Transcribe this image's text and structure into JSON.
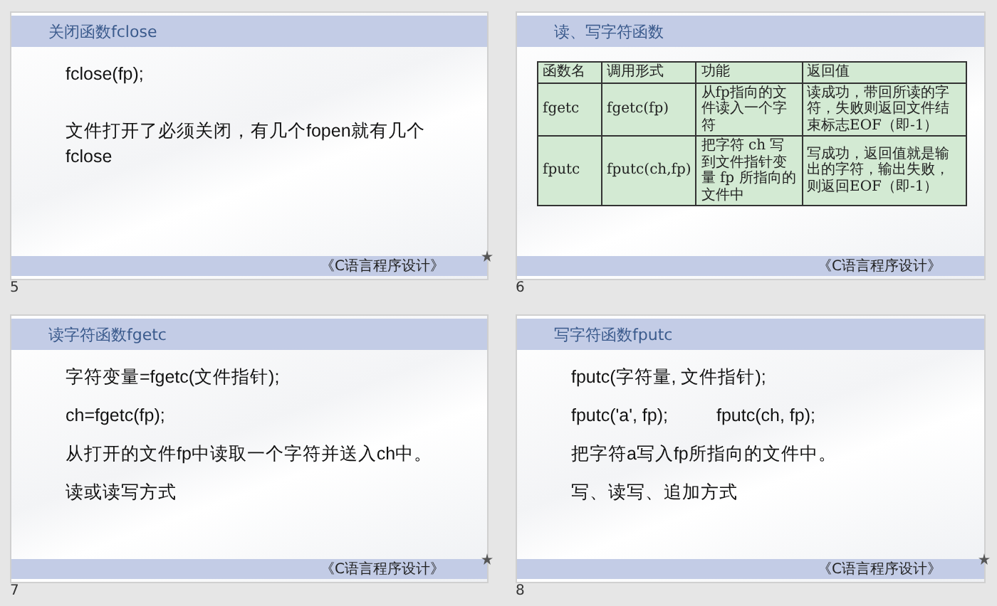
{
  "slides": [
    {
      "number": "5",
      "title": "关闭函数fclose",
      "footer": "《C语言程序设计》",
      "animated": true,
      "body": [
        {
          "kind": "paragraph",
          "texts": [
            "fclose(fp);"
          ]
        },
        {
          "kind": "spacer"
        },
        {
          "kind": "paragraph",
          "texts": [
            "文件打开了必须关闭，有几个fopen就有几个fclose"
          ]
        }
      ]
    },
    {
      "number": "6",
      "title": "读、写字符函数",
      "footer": "《C语言程序设计》",
      "animated": false,
      "body": [
        {
          "kind": "table",
          "columns": [
            "函数名",
            "调用形式",
            "功能",
            "返回值"
          ],
          "rows": [
            [
              "fgetc",
              "fgetc(fp)",
              "从fp指向的文件读入一个字符",
              "读成功，带回所读的字符，失败则返回文件结束标志EOF（即-1）"
            ],
            [
              "fputc",
              "fputc(ch,fp)",
              "把字符 ch 写到文件指针变量 fp 所指向的文件中",
              "写成功，返回值就是输出的字符，输出失败，则返回EOF（即-1）"
            ]
          ]
        }
      ]
    },
    {
      "number": "7",
      "title": "读字符函数fgetc",
      "footer": "《C语言程序设计》",
      "animated": true,
      "body": [
        {
          "kind": "paragraph",
          "texts": [
            "字符变量=fgetc(文件指针);"
          ]
        },
        {
          "kind": "paragraph",
          "texts": [
            "ch=fgetc(fp);"
          ]
        },
        {
          "kind": "paragraph",
          "texts": [
            "从打开的文件fp中读取一个字符并送入ch中。"
          ]
        },
        {
          "kind": "paragraph",
          "texts": [
            "读或读写方式"
          ]
        }
      ]
    },
    {
      "number": "8",
      "title": "写字符函数fputc",
      "footer": "《C语言程序设计》",
      "animated": true,
      "body": [
        {
          "kind": "paragraph",
          "texts": [
            "fputc(字符量, 文件指针);"
          ]
        },
        {
          "kind": "paragraph",
          "texts": [
            "fputc('a', fp);",
            "fputc(ch, fp);"
          ]
        },
        {
          "kind": "paragraph",
          "texts": [
            "把字符a写入fp所指向的文件中。"
          ]
        },
        {
          "kind": "paragraph",
          "texts": [
            "写、读写、追加方式"
          ]
        }
      ]
    }
  ]
}
